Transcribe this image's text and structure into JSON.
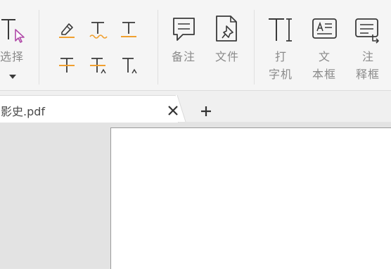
{
  "ribbon": {
    "select_label": "选择",
    "note_label": "备注",
    "file_label": "文件",
    "typewriter_label_line1": "打",
    "typewriter_label_line2": "字机",
    "textbox_label_line1": "文",
    "textbox_label_line2": "本框",
    "callout_label_line1": "注",
    "callout_label_line2": "释框"
  },
  "icons": {
    "select": "text-cursor-select-icon",
    "highlight": "highlighter-icon",
    "squiggly": "squiggly-underline-icon",
    "underline": "underline-text-icon",
    "strikeout": "strikeout-text-icon",
    "replace": "replace-text-icon",
    "insert": "insert-text-icon",
    "note": "note-icon",
    "file": "file-attachment-icon",
    "typewriter": "typewriter-icon",
    "textbox": "textbox-icon",
    "callout": "callout-icon"
  },
  "colors": {
    "accent_orange": "#f0a030",
    "select_cursor": "#b04aa8"
  },
  "tabs": [
    {
      "title": "影史.pdf"
    }
  ]
}
